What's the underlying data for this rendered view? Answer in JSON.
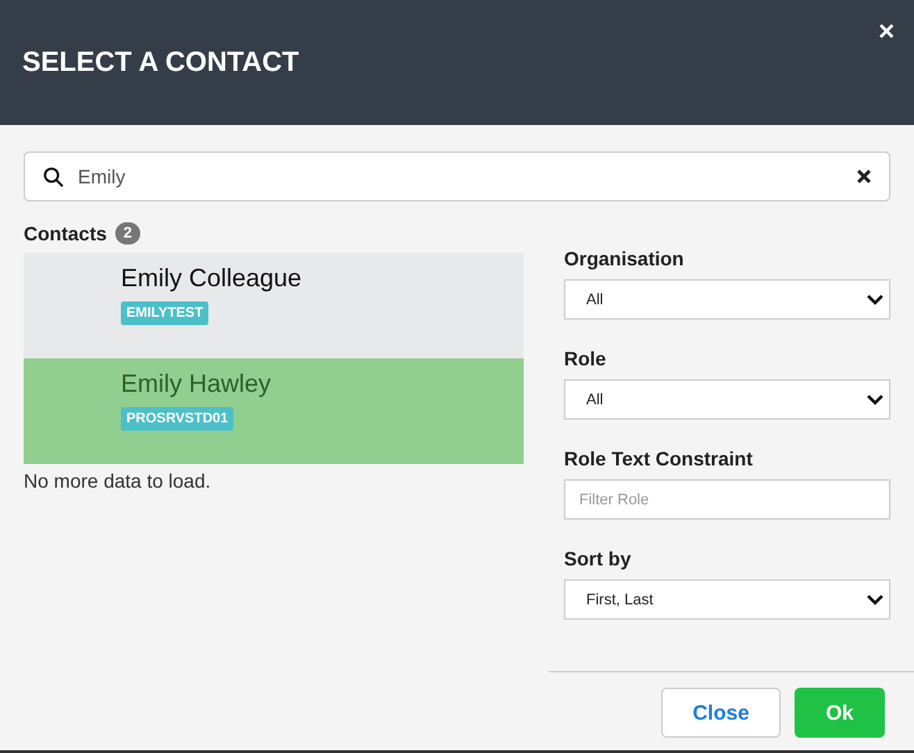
{
  "dialog": {
    "title": "SELECT A CONTACT",
    "close_icon": "×"
  },
  "search": {
    "value": "Emily"
  },
  "contacts": {
    "label": "Contacts",
    "count": "2",
    "items": [
      {
        "name": "Emily Colleague",
        "tag": "EMILYTEST",
        "selected": false
      },
      {
        "name": "Emily Hawley",
        "tag": "PROSRVSTD01",
        "selected": true
      }
    ],
    "footer_note": "No more data to load."
  },
  "filters": [
    {
      "kind": "select",
      "label": "Organisation",
      "value": "All"
    },
    {
      "kind": "select",
      "label": "Role",
      "value": "All"
    },
    {
      "kind": "text",
      "label": "Role Text Constraint",
      "placeholder": "Filter Role"
    },
    {
      "kind": "select",
      "label": "Sort by",
      "value": "First, Last"
    }
  ],
  "buttons": [
    {
      "label": "Close",
      "kind": "secondary"
    },
    {
      "label": "Ok",
      "kind": "primary"
    }
  ]
}
